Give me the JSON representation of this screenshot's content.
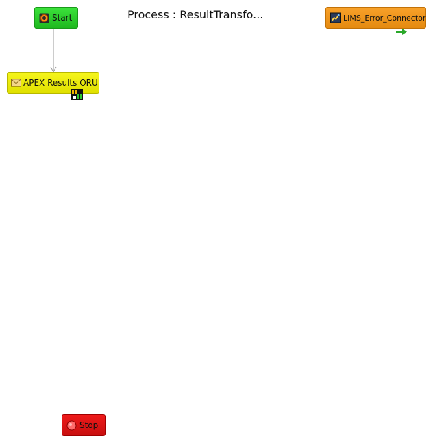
{
  "process": {
    "title": "Process : ResultTransfo..."
  },
  "nodes": {
    "start": {
      "label": "Start",
      "color": "#22c922",
      "icon": "start-icon"
    },
    "apex": {
      "label": "APEX Results ORU",
      "color": "#eeee00",
      "icon": "envelope-icon",
      "badge_icon": "grid-badge-icon"
    },
    "lims": {
      "label": "LIMS_Error_Connector",
      "color": "#f0961a",
      "icon": "connector-icon",
      "badge_icon": "green-arrow-icon"
    },
    "stop": {
      "label": "Stop",
      "color": "#e01414",
      "icon": "stop-icon"
    }
  }
}
